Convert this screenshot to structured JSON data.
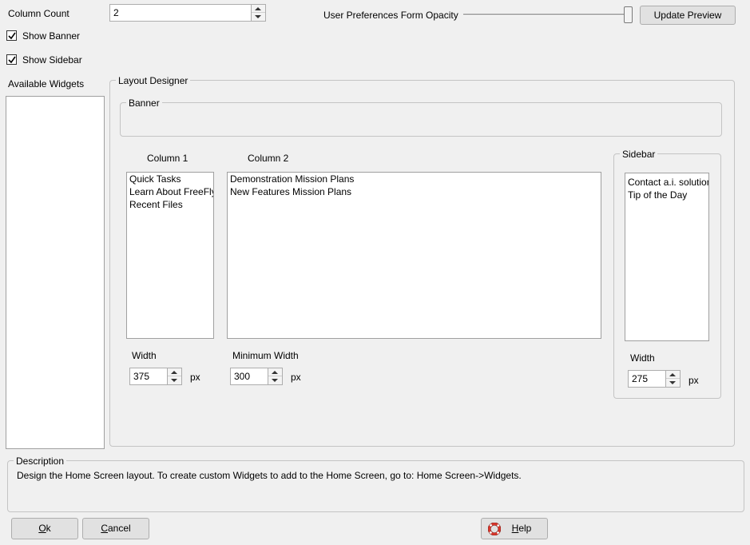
{
  "column_count": {
    "label": "Column Count",
    "value": "2"
  },
  "options": {
    "show_banner": "Show Banner",
    "show_sidebar": "Show Sidebar"
  },
  "opacity": {
    "label": "User Preferences Form Opacity",
    "level": 1.0
  },
  "update_preview": "Update Preview",
  "available_widgets": {
    "label": "Available Widgets",
    "items": []
  },
  "layout": {
    "title": "Layout Designer",
    "banner": "Banner",
    "column1": {
      "title": "Column 1",
      "items": [
        "Quick Tasks",
        "Learn About FreeFly",
        "Recent Files"
      ],
      "width_label": "Width",
      "width": "375",
      "unit": "px"
    },
    "column2": {
      "title": "Column 2",
      "items": [
        "Demonstration Mission Plans",
        "New Features Mission Plans"
      ],
      "width_label": "Minimum Width",
      "width": "300",
      "unit": "px"
    },
    "sidebar": {
      "title": "Sidebar",
      "items": [
        "Contact a.i. solutions",
        "Tip of the Day"
      ],
      "width_label": "Width",
      "width": "275",
      "unit": "px"
    }
  },
  "description": {
    "label": "Description",
    "text": "Design the Home Screen layout.  To create custom Widgets to add to the Home Screen, go to: Home Screen->Widgets."
  },
  "buttons": {
    "ok": {
      "accel": "O",
      "rest": "k"
    },
    "cancel": {
      "accel": "C",
      "rest": "ancel"
    },
    "help": {
      "accel": "H",
      "rest": "elp"
    }
  },
  "icons": {
    "check": "checkmark-icon",
    "help": "lifebuoy-icon"
  },
  "colors": {
    "help_icon": "#d9362b"
  }
}
